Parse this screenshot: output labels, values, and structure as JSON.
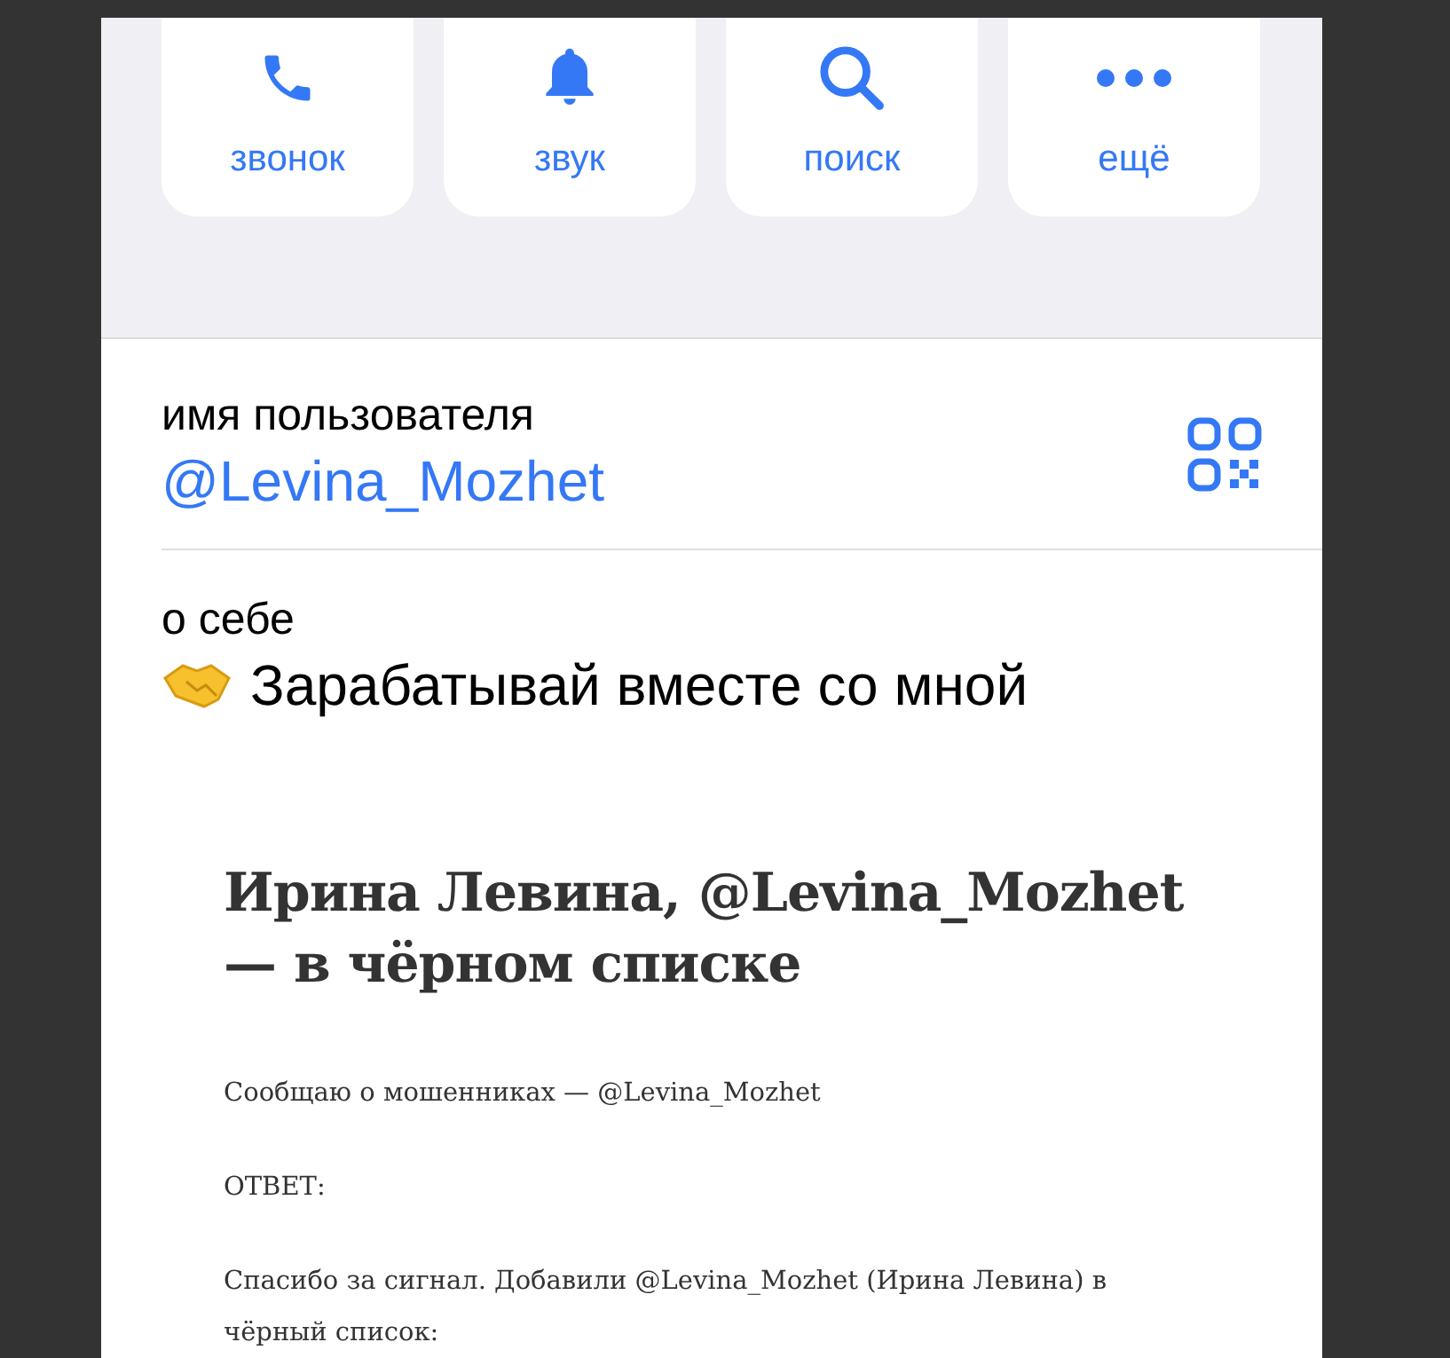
{
  "profile_screenshot": {
    "actions": [
      {
        "kind": "call",
        "label": "звонок"
      },
      {
        "kind": "sound",
        "label": "звук"
      },
      {
        "kind": "search",
        "label": "поиск"
      },
      {
        "kind": "more",
        "label": "ещё"
      }
    ],
    "username": {
      "label": "имя пользователя",
      "value": "@Levina_Mozhet"
    },
    "bio": {
      "label": "о себе",
      "value": "Зарабатывай вместе со мной"
    }
  },
  "article": {
    "title": "Ирина Левина, @Levina_Mozhet — в чёрном списке",
    "paragraphs": [
      "Сообщаю о мошенниках — @Levina_Mozhet",
      "ОТВЕТ:",
      "Спасибо за сигнал. Добавили @Levina_Mozhet (Ирина Левина) в чёрный список:"
    ]
  }
}
